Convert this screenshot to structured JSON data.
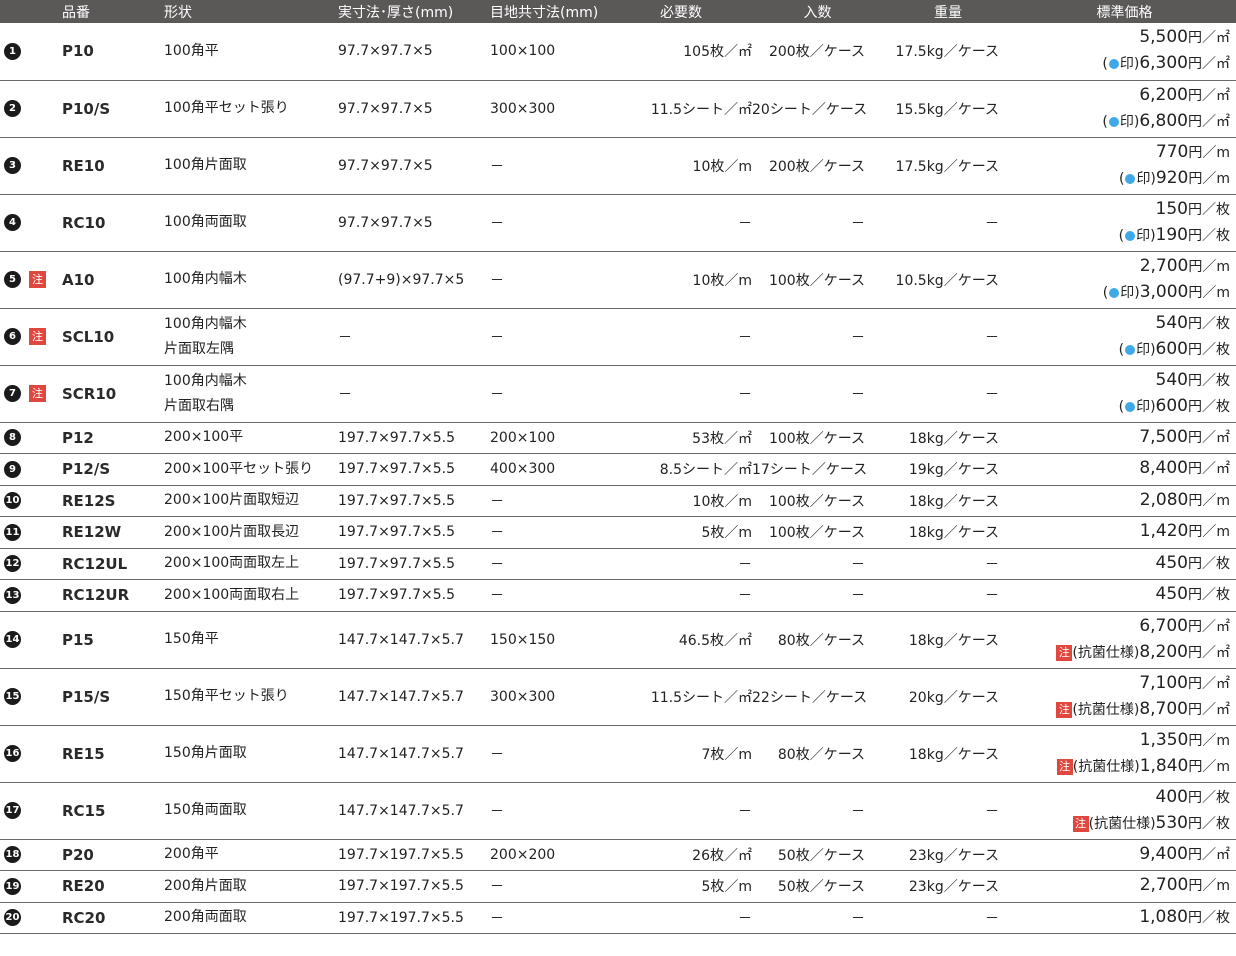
{
  "header": {
    "code": "品番",
    "shape": "形状",
    "size": "実寸法･厚さ(mm)",
    "joint": "目地共寸法(mm)",
    "required": "必要数",
    "qty": "入数",
    "weight": "重量",
    "price": "標準価格"
  },
  "note_label": "注",
  "dot_suffix": "印)",
  "antibac_label": "(抗菌仕様)",
  "rows": [
    {
      "num": "1",
      "code": "P10",
      "shape": [
        "100角平"
      ],
      "size": "97.7×97.7×5",
      "joint": "100×100",
      "req": "105枚／㎡",
      "qty": "200枚／ケース",
      "wt": "17.5kg／ケース",
      "p1": "5,500",
      "u1": "円／㎡",
      "p2": "6,300",
      "u2": "円／㎡"
    },
    {
      "num": "2",
      "code": "P10/S",
      "shape": [
        "100角平セット張り"
      ],
      "size": "97.7×97.7×5",
      "joint": "300×300",
      "req": "11.5シート／㎡",
      "qty": "20シート／ケース",
      "wt": "15.5kg／ケース",
      "p1": "6,200",
      "u1": "円／㎡",
      "p2": "6,800",
      "u2": "円／㎡"
    },
    {
      "num": "3",
      "code": "RE10",
      "shape": [
        "100角片面取"
      ],
      "size": "97.7×97.7×5",
      "joint": "－",
      "req": "10枚／m",
      "qty": "200枚／ケース",
      "wt": "17.5kg／ケース",
      "p1": "770",
      "u1": "円／m",
      "p2": "920",
      "u2": "円／m"
    },
    {
      "num": "4",
      "code": "RC10",
      "shape": [
        "100角両面取"
      ],
      "size": "97.7×97.7×5",
      "joint": "－",
      "req": "－",
      "qty": "－",
      "wt": "－",
      "p1": "150",
      "u1": "円／枚",
      "p2": "190",
      "u2": "円／枚"
    },
    {
      "num": "5",
      "code": "A10",
      "note": true,
      "shape": [
        "100角内幅木"
      ],
      "size": "(97.7+9)×97.7×5",
      "joint": "－",
      "req": "10枚／m",
      "qty": "100枚／ケース",
      "wt": "10.5kg／ケース",
      "p1": "2,700",
      "u1": "円／m",
      "p2": "3,000",
      "u2": "円／m"
    },
    {
      "num": "6",
      "code": "SCL10",
      "note": true,
      "shape": [
        "100角内幅木",
        "片面取左隅"
      ],
      "size": "－",
      "joint": "－",
      "req": "－",
      "qty": "－",
      "wt": "－",
      "p1": "540",
      "u1": "円／枚",
      "p2": "600",
      "u2": "円／枚"
    },
    {
      "num": "7",
      "code": "SCR10",
      "note": true,
      "shape": [
        "100角内幅木",
        "片面取右隅"
      ],
      "size": "－",
      "joint": "－",
      "req": "－",
      "qty": "－",
      "wt": "－",
      "p1": "540",
      "u1": "円／枚",
      "p2": "600",
      "u2": "円／枚"
    },
    {
      "num": "8",
      "code": "P12",
      "shape": [
        "200×100平"
      ],
      "size": "197.7×97.7×5.5",
      "joint": "200×100",
      "req": "53枚／㎡",
      "qty": "100枚／ケース",
      "wt": "18kg／ケース",
      "p1": "7,500",
      "u1": "円／㎡"
    },
    {
      "num": "9",
      "code": "P12/S",
      "shape": [
        "200×100平セット張り"
      ],
      "size": "197.7×97.7×5.5",
      "joint": "400×300",
      "req": "8.5シート／㎡",
      "qty": "17シート／ケース",
      "wt": "19kg／ケース",
      "p1": "8,400",
      "u1": "円／㎡"
    },
    {
      "num": "10",
      "code": "RE12S",
      "shape": [
        "200×100片面取短辺"
      ],
      "size": "197.7×97.7×5.5",
      "joint": "－",
      "req": "10枚／m",
      "qty": "100枚／ケース",
      "wt": "18kg／ケース",
      "p1": "2,080",
      "u1": "円／m"
    },
    {
      "num": "11",
      "code": "RE12W",
      "shape": [
        "200×100片面取長辺"
      ],
      "size": "197.7×97.7×5.5",
      "joint": "－",
      "req": "5枚／m",
      "qty": "100枚／ケース",
      "wt": "18kg／ケース",
      "p1": "1,420",
      "u1": "円／m"
    },
    {
      "num": "12",
      "code": "RC12UL",
      "shape": [
        "200×100両面取左上"
      ],
      "size": "197.7×97.7×5.5",
      "joint": "－",
      "req": "－",
      "qty": "－",
      "wt": "－",
      "p1": "450",
      "u1": "円／枚"
    },
    {
      "num": "13",
      "code": "RC12UR",
      "shape": [
        "200×100両面取右上"
      ],
      "size": "197.7×97.7×5.5",
      "joint": "－",
      "req": "－",
      "qty": "－",
      "wt": "－",
      "p1": "450",
      "u1": "円／枚"
    },
    {
      "num": "14",
      "code": "P15",
      "shape": [
        "150角平"
      ],
      "size": "147.7×147.7×5.7",
      "joint": "150×150",
      "req": "46.5枚／㎡",
      "qty": "80枚／ケース",
      "wt": "18kg／ケース",
      "p1": "6,700",
      "u1": "円／㎡",
      "p2": "8,200",
      "u2": "円／㎡",
      "antibac": true
    },
    {
      "num": "15",
      "code": "P15/S",
      "shape": [
        "150角平セット張り"
      ],
      "size": "147.7×147.7×5.7",
      "joint": "300×300",
      "req": "11.5シート／㎡",
      "qty": "22シート／ケース",
      "wt": "20kg／ケース",
      "p1": "7,100",
      "u1": "円／㎡",
      "p2": "8,700",
      "u2": "円／㎡",
      "antibac": true
    },
    {
      "num": "16",
      "code": "RE15",
      "shape": [
        "150角片面取"
      ],
      "size": "147.7×147.7×5.7",
      "joint": "－",
      "req": "7枚／m",
      "qty": "80枚／ケース",
      "wt": "18kg／ケース",
      "p1": "1,350",
      "u1": "円／m",
      "p2": "1,840",
      "u2": "円／m",
      "antibac": true
    },
    {
      "num": "17",
      "code": "RC15",
      "shape": [
        "150角両面取"
      ],
      "size": "147.7×147.7×5.7",
      "joint": "－",
      "req": "－",
      "qty": "－",
      "wt": "－",
      "p1": "400",
      "u1": "円／枚",
      "p2": "530",
      "u2": "円／枚",
      "antibac": true
    },
    {
      "num": "18",
      "code": "P20",
      "shape": [
        "200角平"
      ],
      "size": "197.7×197.7×5.5",
      "joint": "200×200",
      "req": "26枚／㎡",
      "qty": "50枚／ケース",
      "wt": "23kg／ケース",
      "p1": "9,400",
      "u1": "円／㎡"
    },
    {
      "num": "19",
      "code": "RE20",
      "shape": [
        "200角片面取"
      ],
      "size": "197.7×197.7×5.5",
      "joint": "－",
      "req": "5枚／m",
      "qty": "50枚／ケース",
      "wt": "23kg／ケース",
      "p1": "2,700",
      "u1": "円／m"
    },
    {
      "num": "20",
      "code": "RC20",
      "shape": [
        "200角両面取"
      ],
      "size": "197.7×197.7×5.5",
      "joint": "－",
      "req": "－",
      "qty": "－",
      "wt": "－",
      "p1": "1,080",
      "u1": "円／枚"
    }
  ]
}
